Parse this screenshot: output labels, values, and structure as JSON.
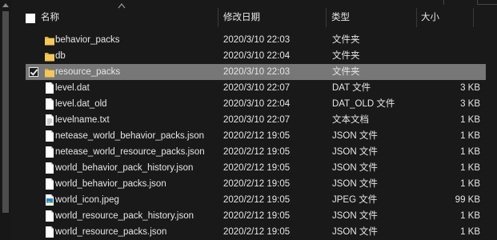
{
  "header": {
    "col_name": "名称",
    "col_date": "修改日期",
    "col_type": "类型",
    "col_size": "大小"
  },
  "files": [
    {
      "name": "behavior_packs",
      "date": "2020/3/10 22:03",
      "type": "文件夹",
      "size": "",
      "icon": "folder-icon",
      "selected": false
    },
    {
      "name": "db",
      "date": "2020/3/10 22:04",
      "type": "文件夹",
      "size": "",
      "icon": "folder-icon",
      "selected": false
    },
    {
      "name": "resource_packs",
      "date": "2020/3/10 22:03",
      "type": "文件夹",
      "size": "",
      "icon": "folder-icon",
      "selected": true
    },
    {
      "name": "level.dat",
      "date": "2020/3/10 22:07",
      "type": "DAT 文件",
      "size": "3 KB",
      "icon": "file-icon",
      "selected": false
    },
    {
      "name": "level.dat_old",
      "date": "2020/3/10 22:04",
      "type": "DAT_OLD 文件",
      "size": "3 KB",
      "icon": "file-icon",
      "selected": false
    },
    {
      "name": "levelname.txt",
      "date": "2020/3/10 22:07",
      "type": "文本文档",
      "size": "1 KB",
      "icon": "text-file-icon",
      "selected": false
    },
    {
      "name": "netease_world_behavior_packs.json",
      "date": "2020/2/12 19:05",
      "type": "JSON 文件",
      "size": "1 KB",
      "icon": "file-icon",
      "selected": false
    },
    {
      "name": "netease_world_resource_packs.json",
      "date": "2020/2/12 19:05",
      "type": "JSON 文件",
      "size": "1 KB",
      "icon": "file-icon",
      "selected": false
    },
    {
      "name": "world_behavior_pack_history.json",
      "date": "2020/2/12 19:05",
      "type": "JSON 文件",
      "size": "1 KB",
      "icon": "file-icon",
      "selected": false
    },
    {
      "name": "world_behavior_packs.json",
      "date": "2020/2/12 19:05",
      "type": "JSON 文件",
      "size": "1 KB",
      "icon": "file-icon",
      "selected": false
    },
    {
      "name": "world_icon.jpeg",
      "date": "2020/2/12 19:05",
      "type": "JPEG 文件",
      "size": "99 KB",
      "icon": "image-file-icon",
      "selected": false
    },
    {
      "name": "world_resource_pack_history.json",
      "date": "2020/2/12 19:05",
      "type": "JSON 文件",
      "size": "1 KB",
      "icon": "file-icon",
      "selected": false
    },
    {
      "name": "world_resource_packs.json",
      "date": "2020/2/12 19:05",
      "type": "JSON 文件",
      "size": "1 KB",
      "icon": "file-icon",
      "selected": false
    }
  ],
  "colors": {
    "background": "#191919",
    "selected_row": "#777777",
    "folder": "#f2c75c",
    "text": "#e6e6e6"
  }
}
